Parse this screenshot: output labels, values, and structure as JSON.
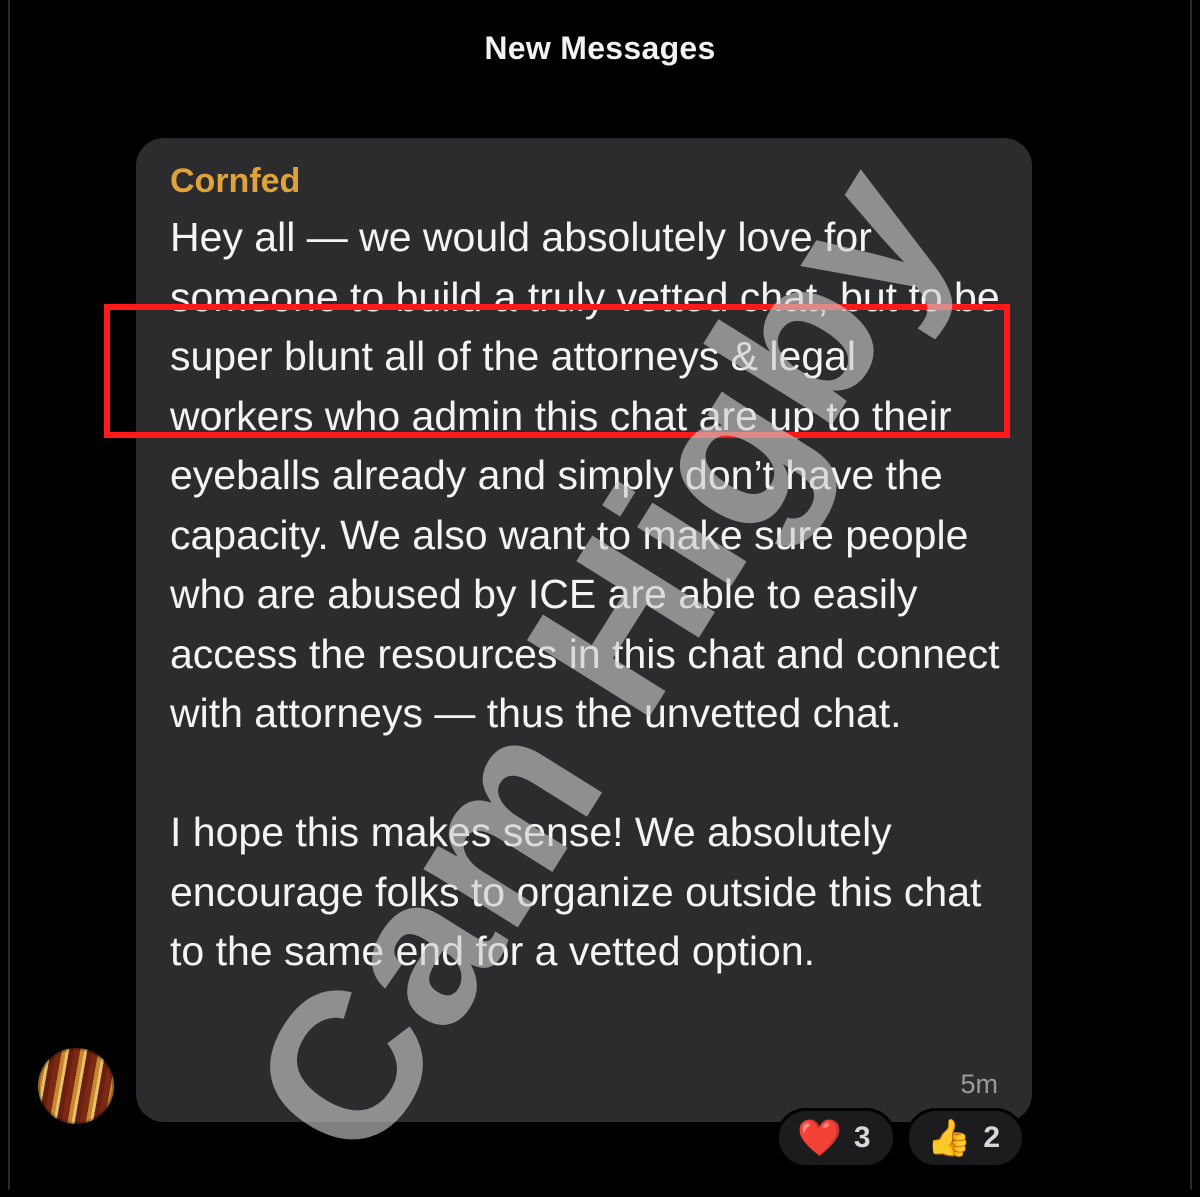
{
  "header": {
    "title": "New Messages"
  },
  "message": {
    "sender": "Cornfed",
    "paragraphs": [
      "Hey all — we would absolutely love for someone to build a truly vetted chat, but to be super blunt all of the attorneys & legal workers who admin this chat are up to their eyeballs already and simply don’t have the capacity. We also want to make sure people who are abused by ICE are able to easily access the resources in this chat and connect with attorneys — thus the unvetted chat.",
      "I hope this makes sense! We absolutely encourage folks to organize outside this chat to the same end for a vetted option."
    ],
    "timestamp": "5m"
  },
  "reactions": [
    {
      "emoji": "❤️",
      "icon": "heart-icon",
      "count": "3"
    },
    {
      "emoji": "👍",
      "icon": "thumbs-up-icon",
      "count": "2"
    }
  ],
  "watermark": {
    "text": "Cam Higby"
  },
  "colors": {
    "sender": "#e0a33a",
    "bubble": "#2c2c2e",
    "highlight": "#ff1a1a"
  }
}
